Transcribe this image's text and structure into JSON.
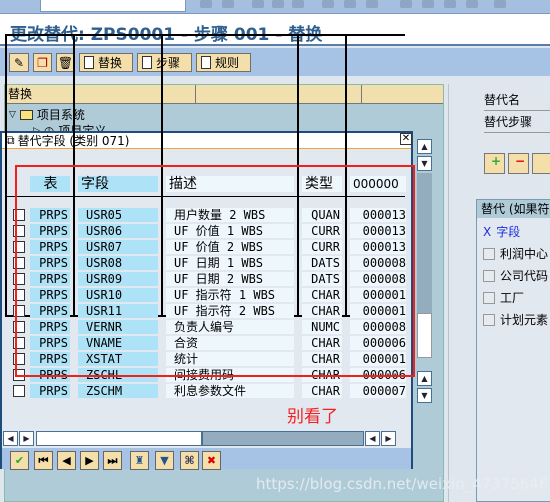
{
  "window": {
    "title": "更改替代: ZPS0001 - 步骤 001 - 替换"
  },
  "toolbar": {
    "buttons": [
      {
        "icon": "edit-icon"
      },
      {
        "icon": "copy-icon"
      },
      {
        "icon": "trash-icon"
      },
      {
        "label": "替换",
        "icon": "document-icon"
      },
      {
        "label": "步骤",
        "icon": "document-icon"
      },
      {
        "label": "规则",
        "icon": "document-icon"
      }
    ]
  },
  "tree": {
    "header": "替换",
    "root": "项目系统",
    "child": "项目定义"
  },
  "right": {
    "name_label": "替代名",
    "step_label": "替代步骤",
    "group_title": "替代 (如果符",
    "items": [
      {
        "label": "字段",
        "marked": "X"
      },
      {
        "label": "利润中心"
      },
      {
        "label": "公司代码"
      },
      {
        "label": "工厂"
      },
      {
        "label": "计划元素"
      }
    ]
  },
  "dialog": {
    "title": "替代字段 (类别 071)",
    "columns": [
      "表",
      "字段",
      "描述",
      "类型",
      "000000"
    ],
    "rows": [
      [
        "PRPS",
        "USR05",
        "用户数量 2 WBS",
        "QUAN",
        "000013"
      ],
      [
        "PRPS",
        "USR06",
        "UF 价值 1 WBS",
        "CURR",
        "000013"
      ],
      [
        "PRPS",
        "USR07",
        "UF 价值 2 WBS",
        "CURR",
        "000013"
      ],
      [
        "PRPS",
        "USR08",
        "UF 日期 1 WBS",
        "DATS",
        "000008"
      ],
      [
        "PRPS",
        "USR09",
        "UF 日期 2 WBS",
        "DATS",
        "000008"
      ],
      [
        "PRPS",
        "USR10",
        "UF 指示符 1 WBS",
        "CHAR",
        "000001"
      ],
      [
        "PRPS",
        "USR11",
        "UF 指示符 2 WBS",
        "CHAR",
        "000001"
      ],
      [
        "PRPS",
        "VERNR",
        "负责人编号",
        "NUMC",
        "000008"
      ],
      [
        "PRPS",
        "VNAME",
        "合资",
        "CHAR",
        "000006"
      ],
      [
        "PRPS",
        "XSTAT",
        "统计",
        "CHAR",
        "000001"
      ],
      [
        "PRPS",
        "ZSCHL",
        "间接费用码",
        "CHAR",
        "000006"
      ],
      [
        "PRPS",
        "ZSCHM",
        "利息参数文件",
        "CHAR",
        "000007"
      ]
    ],
    "annotation": "别看了",
    "footer_buttons": [
      "check-icon",
      "first-page-icon",
      "previous-icon",
      "next-icon",
      "last-page-icon",
      "hierarchy-icon",
      "filter-icon",
      "find-icon",
      "cancel-icon"
    ]
  },
  "watermark": "https://blog.csdn.net/weixin_47375646",
  "colors": {
    "title": "#2f5f8f",
    "header_cell": "#5fc7f5",
    "annotation": "#f52020"
  }
}
